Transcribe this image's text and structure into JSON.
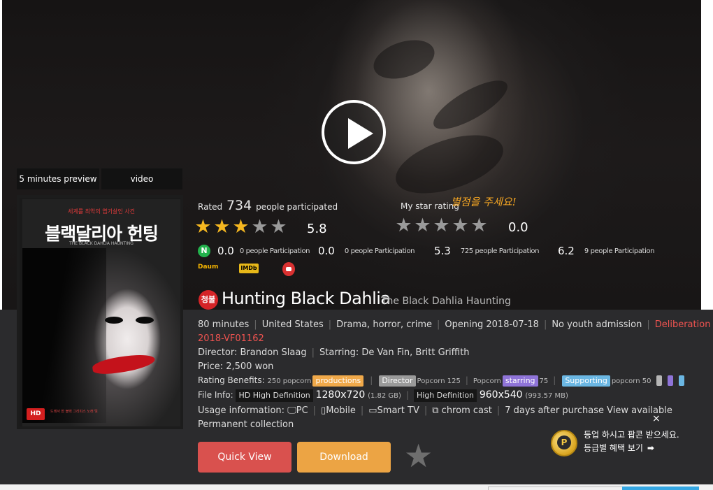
{
  "player": {
    "play_label": "Play",
    "tabs": [
      "5 minutes preview",
      "video"
    ]
  },
  "poster": {
    "tagline": "세계를 최악의 엽기살인 사건",
    "title_kr": "블랙달리아 헌팅",
    "subtitle": "THE BLACK DAHLIA HAUNTING",
    "credits": "드레서 한 블랙 그리피스 노래 덫",
    "hd_badge": "HD"
  },
  "rating": {
    "rated_prefix": "Rated",
    "rated_count": "734",
    "rated_suffix": "people participated",
    "site_score": "5.8",
    "site_stars_filled": 3,
    "site_stars_total": 5,
    "my_label": "My star rating",
    "my_handwritten": "별점을 주세요!",
    "my_score": "0.0",
    "my_stars_filled": 0
  },
  "external_ratings": [
    {
      "source": "naver-icon",
      "logo": "N",
      "score": "0.0",
      "participation": "0 people Participation"
    },
    {
      "source": "daum-icon",
      "logo": "Daum",
      "score": "0.0",
      "participation": "0 people Participation"
    },
    {
      "source": "imdb-icon",
      "logo": "IMDb",
      "score": "5.3",
      "participation": "725 people Participation"
    },
    {
      "source": "watcha-icon",
      "logo": "",
      "score": "6.2",
      "participation": "9 people Participation"
    }
  ],
  "movie": {
    "age_badge": "청불",
    "title": "Hunting Black Dahlia",
    "original_title": "The Black Dahlia Haunting",
    "runtime": "80 minutes",
    "country": "United States",
    "genre": "Drama, horror, crime",
    "opening": "Opening 2018-07-18",
    "age_rating": "No youth admission",
    "deliberation": "Deliberation",
    "deliberation_code": "2018-VF01162",
    "director": "Director: Brandon Slaag",
    "starring": "Starring: De Van Fin, Britt Griffith",
    "price": "Price: 2,500 won"
  },
  "benefits": {
    "label": "Rating Benefits:",
    "prod_points": "250 popcorn",
    "prod_tag": "productions",
    "director_tag": "Director",
    "director_points": "Popcorn 125",
    "starring_pre": "Popcorn",
    "starring_tag": "starring",
    "starring_points": "75",
    "supporting_tag": "Supporting",
    "supporting_points": "popcorn 50"
  },
  "file_info": {
    "label": "File Info:",
    "hd_tag": "HD High Definition",
    "hd_res": "1280x720",
    "hd_size": "(1.82 GB)",
    "sd_tag": "High Definition",
    "sd_res": "960x540",
    "sd_size": "(993.57 MB)"
  },
  "usage": {
    "label": "Usage information:",
    "pc": "PC",
    "mobile": "Mobile",
    "tv": "Smart TV",
    "cast": "chrom cast",
    "note": "7 days after purchase View available",
    "permanent": "Permanent collection"
  },
  "actions": {
    "quick_view": "Quick View",
    "download": "Download"
  },
  "popup": {
    "close": "×",
    "coin": "P",
    "line1": "등업 하시고 팝콘 받으세요.",
    "line2": "등급별 혜택 보기",
    "arrow": "➡"
  },
  "colors": {
    "star_on": "#f5b720",
    "quick_view": "#d9514e",
    "download": "#eca444",
    "deliberation": "#ef5350"
  }
}
